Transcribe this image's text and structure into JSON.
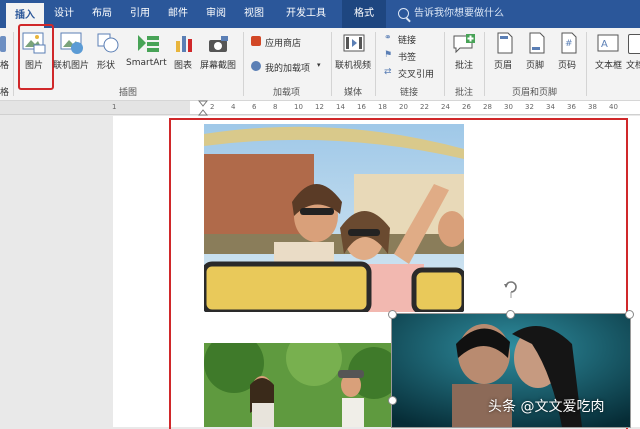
{
  "tabs": [
    "插入",
    "设计",
    "布局",
    "引用",
    "邮件",
    "审阅",
    "视图",
    "开发工具",
    "格式"
  ],
  "search_text": "告诉我你想要做什么",
  "ribbon": {
    "partial_left_1": "格",
    "partial_left_2": "格",
    "picture": "图片",
    "online_picture": "联机图片",
    "shapes": "形状",
    "smartart": "SmartArt",
    "chart": "图表",
    "screenshot": "屏幕截图",
    "store": "应用商店",
    "my_addins": "我的加载项",
    "online_video": "联机视频",
    "link": "链接",
    "bookmark": "书签",
    "cross_ref": "交叉引用",
    "comment": "批注",
    "header": "页眉",
    "footer": "页脚",
    "page_number": "页码",
    "textbox": "文本框",
    "partial_right": "文档",
    "groups": {
      "illustrations": "插图",
      "addins": "加载项",
      "media": "媒体",
      "links": "链接",
      "comments": "批注",
      "header_footer": "页眉和页脚"
    }
  },
  "ruler_marks": [
    "1",
    "2",
    "4",
    "6",
    "8",
    "10",
    "12",
    "14",
    "16",
    "18",
    "20",
    "22",
    "24",
    "26",
    "28",
    "30",
    "32",
    "34",
    "36",
    "38",
    "40"
  ],
  "watermark": "头条 @文文爱吃肉",
  "colors": {
    "accent": "#2b579a",
    "highlight": "#d0282a"
  }
}
